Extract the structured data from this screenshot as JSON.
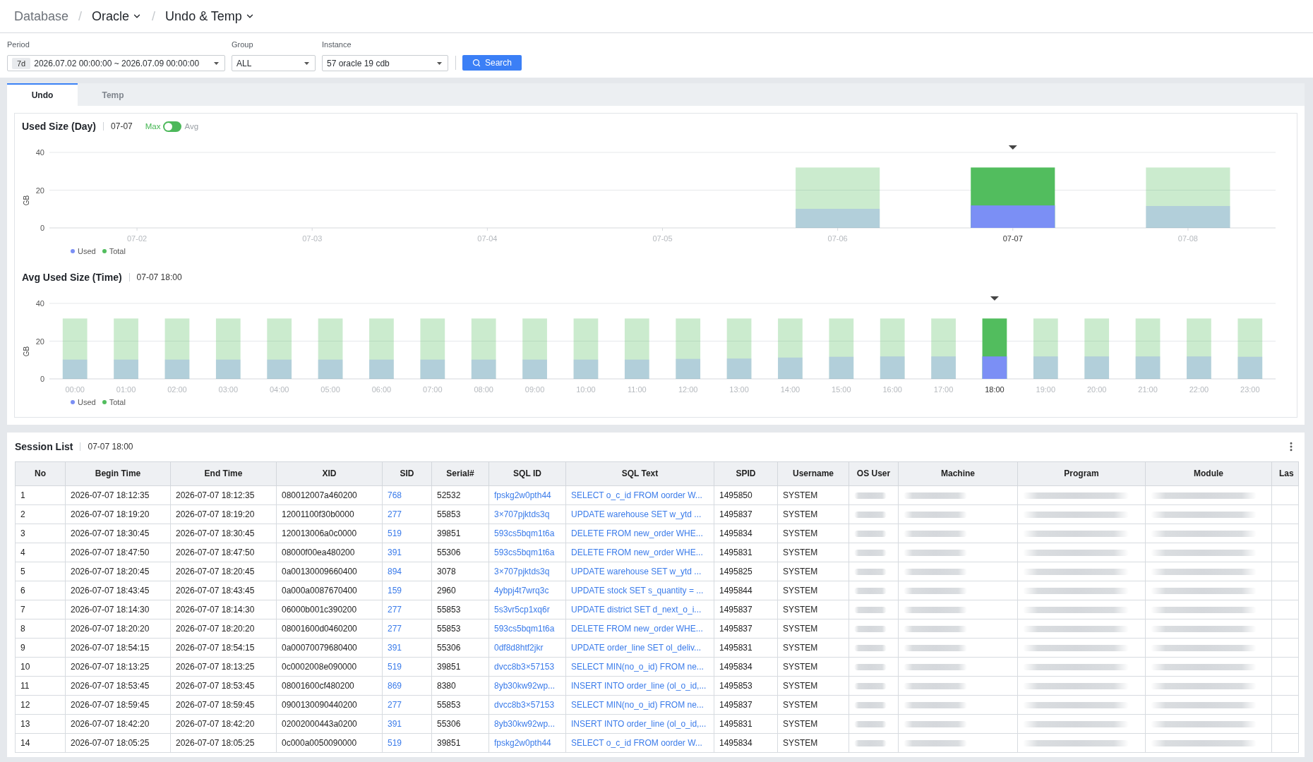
{
  "breadcrumb": {
    "separator": "/",
    "items": [
      {
        "label": "Database",
        "kind": "link"
      },
      {
        "label": "Oracle",
        "kind": "menu"
      },
      {
        "label": "Undo & Temp",
        "kind": "menu"
      }
    ]
  },
  "filters": [
    {
      "label": "Period",
      "kind": "period",
      "chip": "7d",
      "value": "2026.07.02 00:00:00 ~ 2026.07.09 00:00:00"
    },
    {
      "label": "Group",
      "kind": "select",
      "value": "ALL"
    },
    {
      "label": "Instance",
      "kind": "select",
      "value": "57 oracle 19 cdb"
    }
  ],
  "search_button": {
    "label": "Search"
  },
  "tabs": [
    {
      "label": "Undo",
      "selected": true
    },
    {
      "label": "Temp",
      "selected": false
    }
  ],
  "charts": [
    {
      "title": "Used Size (Day)",
      "selection": "07-07",
      "toggle": {
        "options": [
          {
            "label": "Max",
            "selected": true
          },
          {
            "label": "Avg",
            "selected": false
          }
        ]
      },
      "bars": [
        {
          "selected": false
        },
        {
          "selected": false
        },
        {
          "selected": false
        },
        {
          "selected": false
        },
        {
          "selected": false
        },
        {
          "selected": true
        },
        {
          "selected": false
        }
      ],
      "chart_data": {
        "type": "bar",
        "ylabel": "GB",
        "categories": [
          "07-02",
          "07-03",
          "07-04",
          "07-05",
          "07-06",
          "07-07",
          "07-08"
        ],
        "series": [
          {
            "name": "Used",
            "color": "#7b8ff5",
            "values": [
              0,
              0,
              0,
              0,
              10.1,
              11.9,
              11.6
            ]
          },
          {
            "name": "Total",
            "color": "#52bd5e",
            "values": [
              0,
              0,
              0,
              0,
              32,
              32,
              32
            ]
          }
        ],
        "ylim": [
          0,
          40
        ],
        "yticks": [
          0,
          20,
          40
        ],
        "stacked": false
      }
    },
    {
      "title": "Avg Used Size (Time)",
      "selection": "07-07 18:00",
      "bars": [
        {
          "selected": false
        },
        {
          "selected": false
        },
        {
          "selected": false
        },
        {
          "selected": false
        },
        {
          "selected": false
        },
        {
          "selected": false
        },
        {
          "selected": false
        },
        {
          "selected": false
        },
        {
          "selected": false
        },
        {
          "selected": false
        },
        {
          "selected": false
        },
        {
          "selected": false
        },
        {
          "selected": false
        },
        {
          "selected": false
        },
        {
          "selected": false
        },
        {
          "selected": false
        },
        {
          "selected": false
        },
        {
          "selected": false
        },
        {
          "selected": true
        },
        {
          "selected": false
        },
        {
          "selected": false
        },
        {
          "selected": false
        },
        {
          "selected": false
        },
        {
          "selected": false
        }
      ],
      "chart_data": {
        "type": "bar",
        "ylabel": "GB",
        "categories": [
          "00:00",
          "01:00",
          "02:00",
          "03:00",
          "04:00",
          "05:00",
          "06:00",
          "07:00",
          "08:00",
          "09:00",
          "10:00",
          "11:00",
          "12:00",
          "13:00",
          "14:00",
          "15:00",
          "16:00",
          "17:00",
          "18:00",
          "19:00",
          "20:00",
          "21:00",
          "22:00",
          "23:00"
        ],
        "series": [
          {
            "name": "Used",
            "color": "#7b8ff5",
            "values": [
              10.2,
              10.2,
              10.2,
              10.2,
              10.2,
              10.2,
              10.2,
              10.2,
              10.2,
              10.2,
              10.2,
              10.2,
              10.6,
              10.8,
              11.3,
              11.7,
              11.9,
              11.9,
              11.9,
              11.9,
              11.9,
              11.9,
              11.9,
              11.7
            ]
          },
          {
            "name": "Total",
            "color": "#52bd5e",
            "values": [
              32,
              32,
              32,
              32,
              32,
              32,
              32,
              32,
              32,
              32,
              32,
              32,
              32,
              32,
              32,
              32,
              32,
              32,
              32,
              32,
              32,
              32,
              32,
              32
            ]
          }
        ],
        "ylim": [
          0,
          40
        ],
        "yticks": [
          0,
          20,
          40
        ],
        "stacked": false
      }
    }
  ],
  "session_list": {
    "title": "Session List",
    "selection": "07-07 18:00",
    "table": {
      "columns": [
        {
          "label": "No",
          "kind": "text"
        },
        {
          "label": "Begin Time",
          "kind": "text"
        },
        {
          "label": "End Time",
          "kind": "text"
        },
        {
          "label": "XID",
          "kind": "text"
        },
        {
          "label": "SID",
          "kind": "link"
        },
        {
          "label": "Serial#",
          "kind": "text"
        },
        {
          "label": "SQL ID",
          "kind": "link"
        },
        {
          "label": "SQL Text",
          "kind": "link"
        },
        {
          "label": "SPID",
          "kind": "text"
        },
        {
          "label": "Username",
          "kind": "text"
        },
        {
          "label": "OS User",
          "kind": "redacted"
        },
        {
          "label": "Machine",
          "kind": "redacted"
        },
        {
          "label": "Program",
          "kind": "redacted"
        },
        {
          "label": "Module",
          "kind": "redacted"
        },
        {
          "label": "Las",
          "kind": "blank"
        }
      ],
      "rows": [
        {
          "cells": [
            "1",
            "2026-07-07 18:12:35",
            "2026-07-07 18:12:35",
            "080012007a460200",
            "768",
            "52532",
            "fpskg2w0pth44",
            "SELECT o_c_id FROM oorder W...",
            "1495850",
            "SYSTEM"
          ]
        },
        {
          "cells": [
            "2",
            "2026-07-07 18:19:20",
            "2026-07-07 18:19:20",
            "12001100f30b0000",
            "277",
            "55853",
            "3×707pjktds3q",
            "UPDATE warehouse SET w_ytd ...",
            "1495837",
            "SYSTEM"
          ]
        },
        {
          "cells": [
            "3",
            "2026-07-07 18:30:45",
            "2026-07-07 18:30:45",
            "120013006a0c0000",
            "519",
            "39851",
            "593cs5bqm1t6a",
            "DELETE FROM new_order WHE...",
            "1495834",
            "SYSTEM"
          ]
        },
        {
          "cells": [
            "4",
            "2026-07-07 18:47:50",
            "2026-07-07 18:47:50",
            "08000f00ea480200",
            "391",
            "55306",
            "593cs5bqm1t6a",
            "DELETE FROM new_order WHE...",
            "1495831",
            "SYSTEM"
          ]
        },
        {
          "cells": [
            "5",
            "2026-07-07 18:20:45",
            "2026-07-07 18:20:45",
            "0a00130009660400",
            "894",
            "3078",
            "3×707pjktds3q",
            "UPDATE warehouse SET w_ytd ...",
            "1495825",
            "SYSTEM"
          ]
        },
        {
          "cells": [
            "6",
            "2026-07-07 18:43:45",
            "2026-07-07 18:43:45",
            "0a000a0087670400",
            "159",
            "2960",
            "4ybpj4t7wrq3c",
            "UPDATE stock SET s_quantity = ...",
            "1495844",
            "SYSTEM"
          ]
        },
        {
          "cells": [
            "7",
            "2026-07-07 18:14:30",
            "2026-07-07 18:14:30",
            "06000b001c390200",
            "277",
            "55853",
            "5s3vr5cp1xq6r",
            "UPDATE district SET d_next_o_i...",
            "1495837",
            "SYSTEM"
          ]
        },
        {
          "cells": [
            "8",
            "2026-07-07 18:20:20",
            "2026-07-07 18:20:20",
            "08001600d0460200",
            "277",
            "55853",
            "593cs5bqm1t6a",
            "DELETE FROM new_order WHE...",
            "1495837",
            "SYSTEM"
          ]
        },
        {
          "cells": [
            "9",
            "2026-07-07 18:54:15",
            "2026-07-07 18:54:15",
            "0a00070079680400",
            "391",
            "55306",
            "0df8d8htf2jkr",
            "UPDATE order_line SET ol_deliv...",
            "1495831",
            "SYSTEM"
          ]
        },
        {
          "cells": [
            "10",
            "2026-07-07 18:13:25",
            "2026-07-07 18:13:25",
            "0c0002008e090000",
            "519",
            "39851",
            "dvcc8b3×57153",
            "SELECT MIN(no_o_id) FROM ne...",
            "1495834",
            "SYSTEM"
          ]
        },
        {
          "cells": [
            "11",
            "2026-07-07 18:53:45",
            "2026-07-07 18:53:45",
            "08001600cf480200",
            "869",
            "8380",
            "8yb30kw92wp...",
            "INSERT INTO order_line (ol_o_id,...",
            "1495853",
            "SYSTEM"
          ]
        },
        {
          "cells": [
            "12",
            "2026-07-07 18:59:45",
            "2026-07-07 18:59:45",
            "0900130090440200",
            "277",
            "55853",
            "dvcc8b3×57153",
            "SELECT MIN(no_o_id) FROM ne...",
            "1495837",
            "SYSTEM"
          ]
        },
        {
          "cells": [
            "13",
            "2026-07-07 18:42:20",
            "2026-07-07 18:42:20",
            "02002000443a0200",
            "391",
            "55306",
            "8yb30kw92wp...",
            "INSERT INTO order_line (ol_o_id,...",
            "1495831",
            "SYSTEM"
          ]
        },
        {
          "cells": [
            "14",
            "2026-07-07 18:05:25",
            "2026-07-07 18:05:25",
            "0c000a0050090000",
            "519",
            "39851",
            "fpskg2w0pth44",
            "SELECT o_c_id FROM oorder W...",
            "1495834",
            "SYSTEM"
          ]
        }
      ]
    }
  }
}
